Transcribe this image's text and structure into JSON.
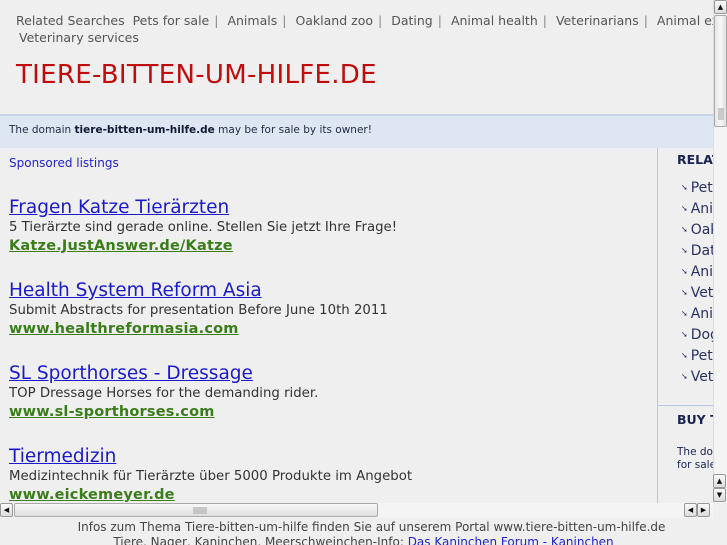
{
  "related_top": {
    "label": "Related Searches",
    "items": [
      "Pets for sale",
      "Animals",
      "Oakland zoo",
      "Dating",
      "Animal health",
      "Veterinarians",
      "Animal examination"
    ],
    "line2": "Veterinary services"
  },
  "site_title": "TIERE-BITTEN-UM-HILFE.DE",
  "sale_bar": {
    "prefix": "The domain ",
    "domain": "tiere-bitten-um-hilfe.de",
    "suffix": " may be for sale by its owner!"
  },
  "sponsored_label": "Sponsored listings",
  "listings": [
    {
      "title": "Fragen Katze Tierärzten",
      "desc": "5 Tierärzte sind gerade online. Stellen Sie jetzt Ihre Frage!",
      "url": "Katze.JustAnswer.de/Katze"
    },
    {
      "title": "Health System Reform Asia",
      "desc": "Submit Abstracts for presentation Before June 10th 2011",
      "url": "www.healthreformasia.com"
    },
    {
      "title": "SL Sporthorses - Dressage",
      "desc": "TOP Dressage Horses for the demanding rider.",
      "url": "www.sl-sporthorses.com"
    },
    {
      "title": "Tiermedizin",
      "desc": "Medizintechnik für Tierärzte über 5000 Produkte im Angebot",
      "url": "www.eickemeyer.de"
    }
  ],
  "sidebar": {
    "heading": "RELATED SEARCHES",
    "items": [
      "Pets for sale",
      "Animals",
      "Oakland zoo",
      "Dating",
      "Animal health",
      "Veterinarians",
      "Animal examination",
      "Dogs",
      "Pet",
      "Veterinary services"
    ],
    "buy_heading": "BUY THIS DOMAIN",
    "buy_text_1": "The domain",
    "buy_text_2": "for sale"
  },
  "footer": {
    "line1": "Infos zum Thema Tiere-bitten-um-hilfe finden Sie auf unserem Portal www.tiere-bitten-um-hilfe.de",
    "line2_prefix": "Tiere, Nager, Kaninchen, Meerschweinchen-Info: ",
    "line2_link": "Das Kaninchen Forum - Kaninchen"
  },
  "icons": {
    "up": "▲",
    "down": "▼",
    "left": "◀",
    "right": "▶",
    "bullet": "➘"
  }
}
